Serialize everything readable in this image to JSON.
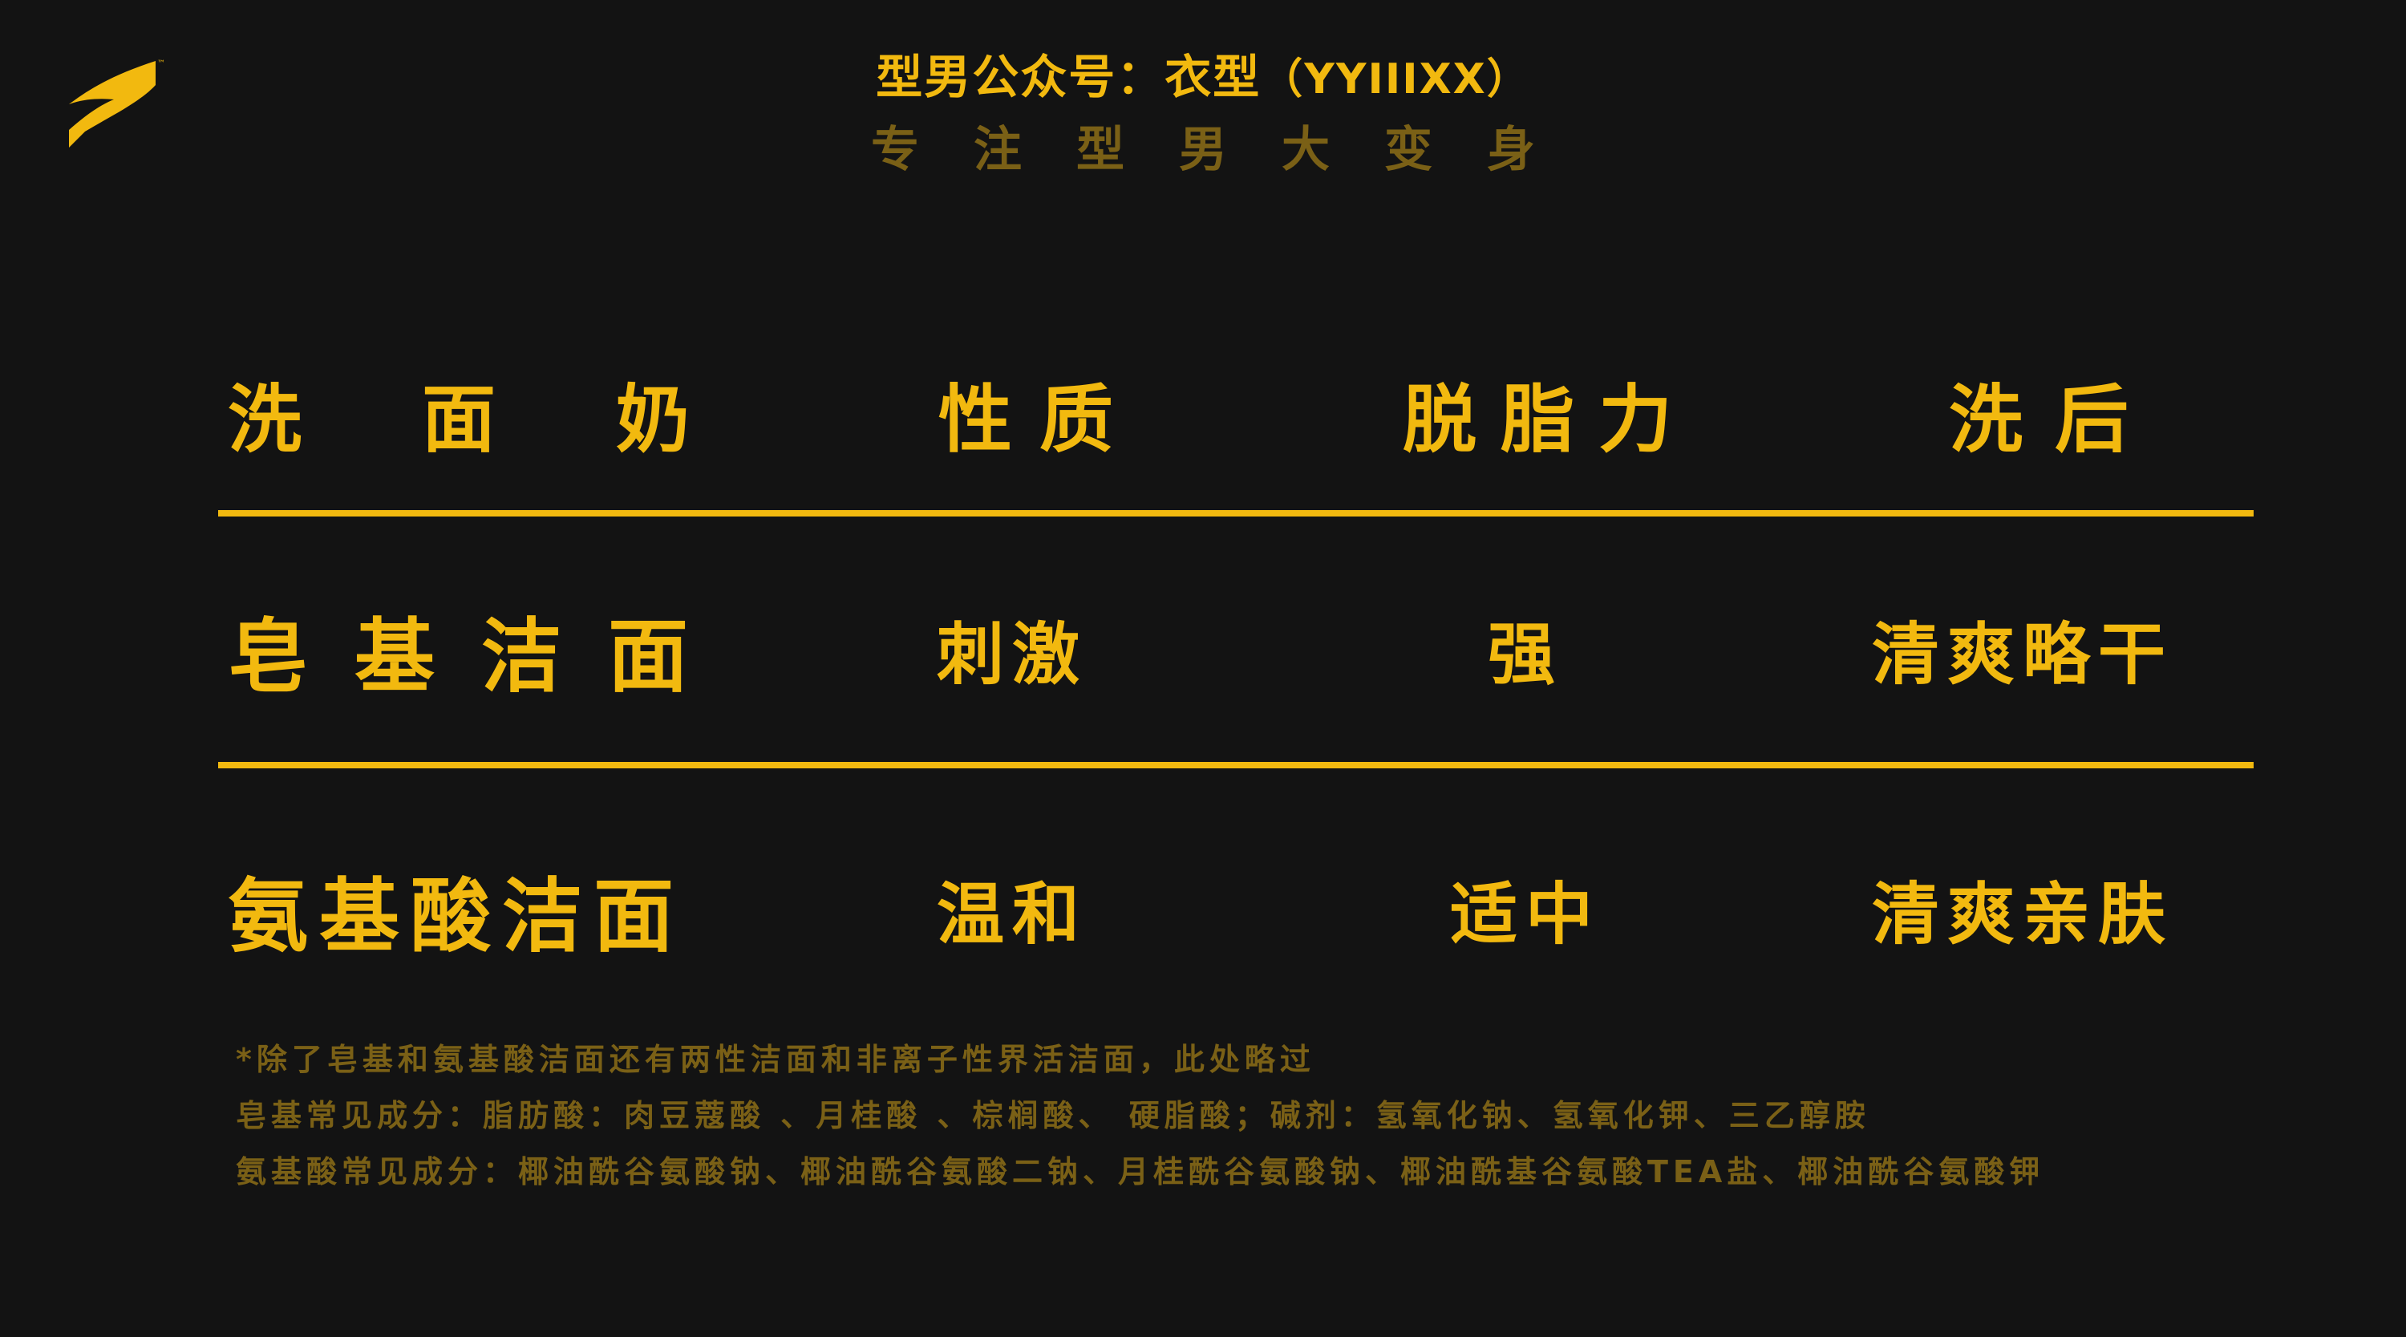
{
  "header": {
    "brand_prefix": "型男公众号：衣型",
    "brand_suffix": "（YYIIIXX）",
    "slogan": "专注型男大变身"
  },
  "table": {
    "headers": [
      "洗面奶",
      "性质",
      "脱脂力",
      "洗后"
    ],
    "rows": [
      [
        "皂基洁面",
        "刺激",
        "强",
        "清爽略干"
      ],
      [
        "氨基酸洁面",
        "温和",
        "适中",
        "清爽亲肤"
      ]
    ]
  },
  "notes": [
    "*除了皂基和氨基酸洁面还有两性洁面和非离子性界活洁面，此处略过",
    "皂基常见成分：脂肪酸：肉豆蔻酸 、月桂酸 、棕榈酸、 硬脂酸；碱剂：氢氧化钠、氢氧化钾、三乙醇胺",
    "氨基酸常见成分：椰油酰谷氨酸钠、椰油酰谷氨酸二钠、月桂酰谷氨酸钠、椰油酰基谷氨酸TEA盐、椰油酰谷氨酸钾"
  ],
  "colors": {
    "background": "#131313",
    "accent": "#f2b90f",
    "muted": "#7a6016"
  },
  "icons": {
    "logo": "brand-logo-icon"
  }
}
